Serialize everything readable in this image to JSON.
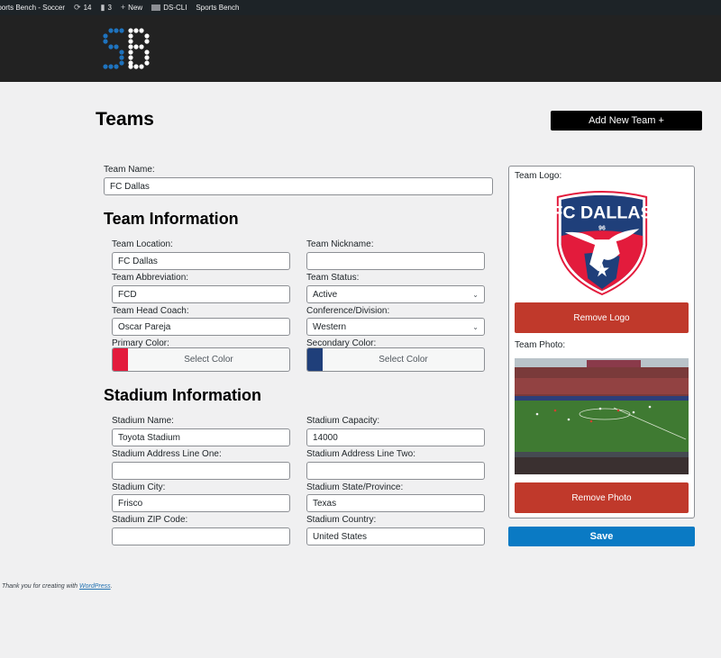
{
  "adminbar": {
    "site_name": "Sports Bench - Soccer",
    "updates_count": "14",
    "comments_count": "3",
    "new_label": "New",
    "dscli_label": "DS-CLI",
    "plugin_label": "Sports Bench"
  },
  "page": {
    "title": "Teams",
    "add_button": "Add New Team +"
  },
  "team_name": {
    "label": "Team Name:",
    "value": "FC Dallas"
  },
  "team_info": {
    "heading": "Team Information",
    "location": {
      "label": "Team Location:",
      "value": "FC Dallas"
    },
    "nickname": {
      "label": "Team Nickname:",
      "value": ""
    },
    "abbreviation": {
      "label": "Team Abbreviation:",
      "value": "FCD"
    },
    "status": {
      "label": "Team Status:",
      "value": "Active"
    },
    "head_coach": {
      "label": "Team Head Coach:",
      "value": "Oscar Pareja"
    },
    "conference": {
      "label": "Conference/Division:",
      "value": "Western"
    },
    "primary_color": {
      "label": "Primary Color:",
      "button": "Select Color",
      "color": "#e31b3c"
    },
    "secondary_color": {
      "label": "Secondary Color:",
      "button": "Select Color",
      "color": "#1f3f7a"
    }
  },
  "stadium_info": {
    "heading": "Stadium Information",
    "name": {
      "label": "Stadium Name:",
      "value": "Toyota Stadium"
    },
    "capacity": {
      "label": "Stadium Capacity:",
      "value": "14000"
    },
    "address1": {
      "label": "Stadium Address Line One:",
      "value": ""
    },
    "address2": {
      "label": "Stadium Address Line Two:",
      "value": ""
    },
    "city": {
      "label": "Stadium City:",
      "value": "Frisco"
    },
    "state": {
      "label": "Stadium State/Province:",
      "value": "Texas"
    },
    "zip": {
      "label": "Stadium ZIP Code:",
      "value": ""
    },
    "country": {
      "label": "Stadium Country:",
      "value": "United States"
    }
  },
  "sidebar": {
    "logo_label": "Team Logo:",
    "logo_text": "FC DALLAS",
    "logo_year": "96",
    "remove_logo": "Remove Logo",
    "photo_label": "Team Photo:",
    "remove_photo": "Remove Photo"
  },
  "save_button": "Save",
  "footer": {
    "text": "Thank you for creating with ",
    "link": "WordPress",
    "end": "."
  }
}
